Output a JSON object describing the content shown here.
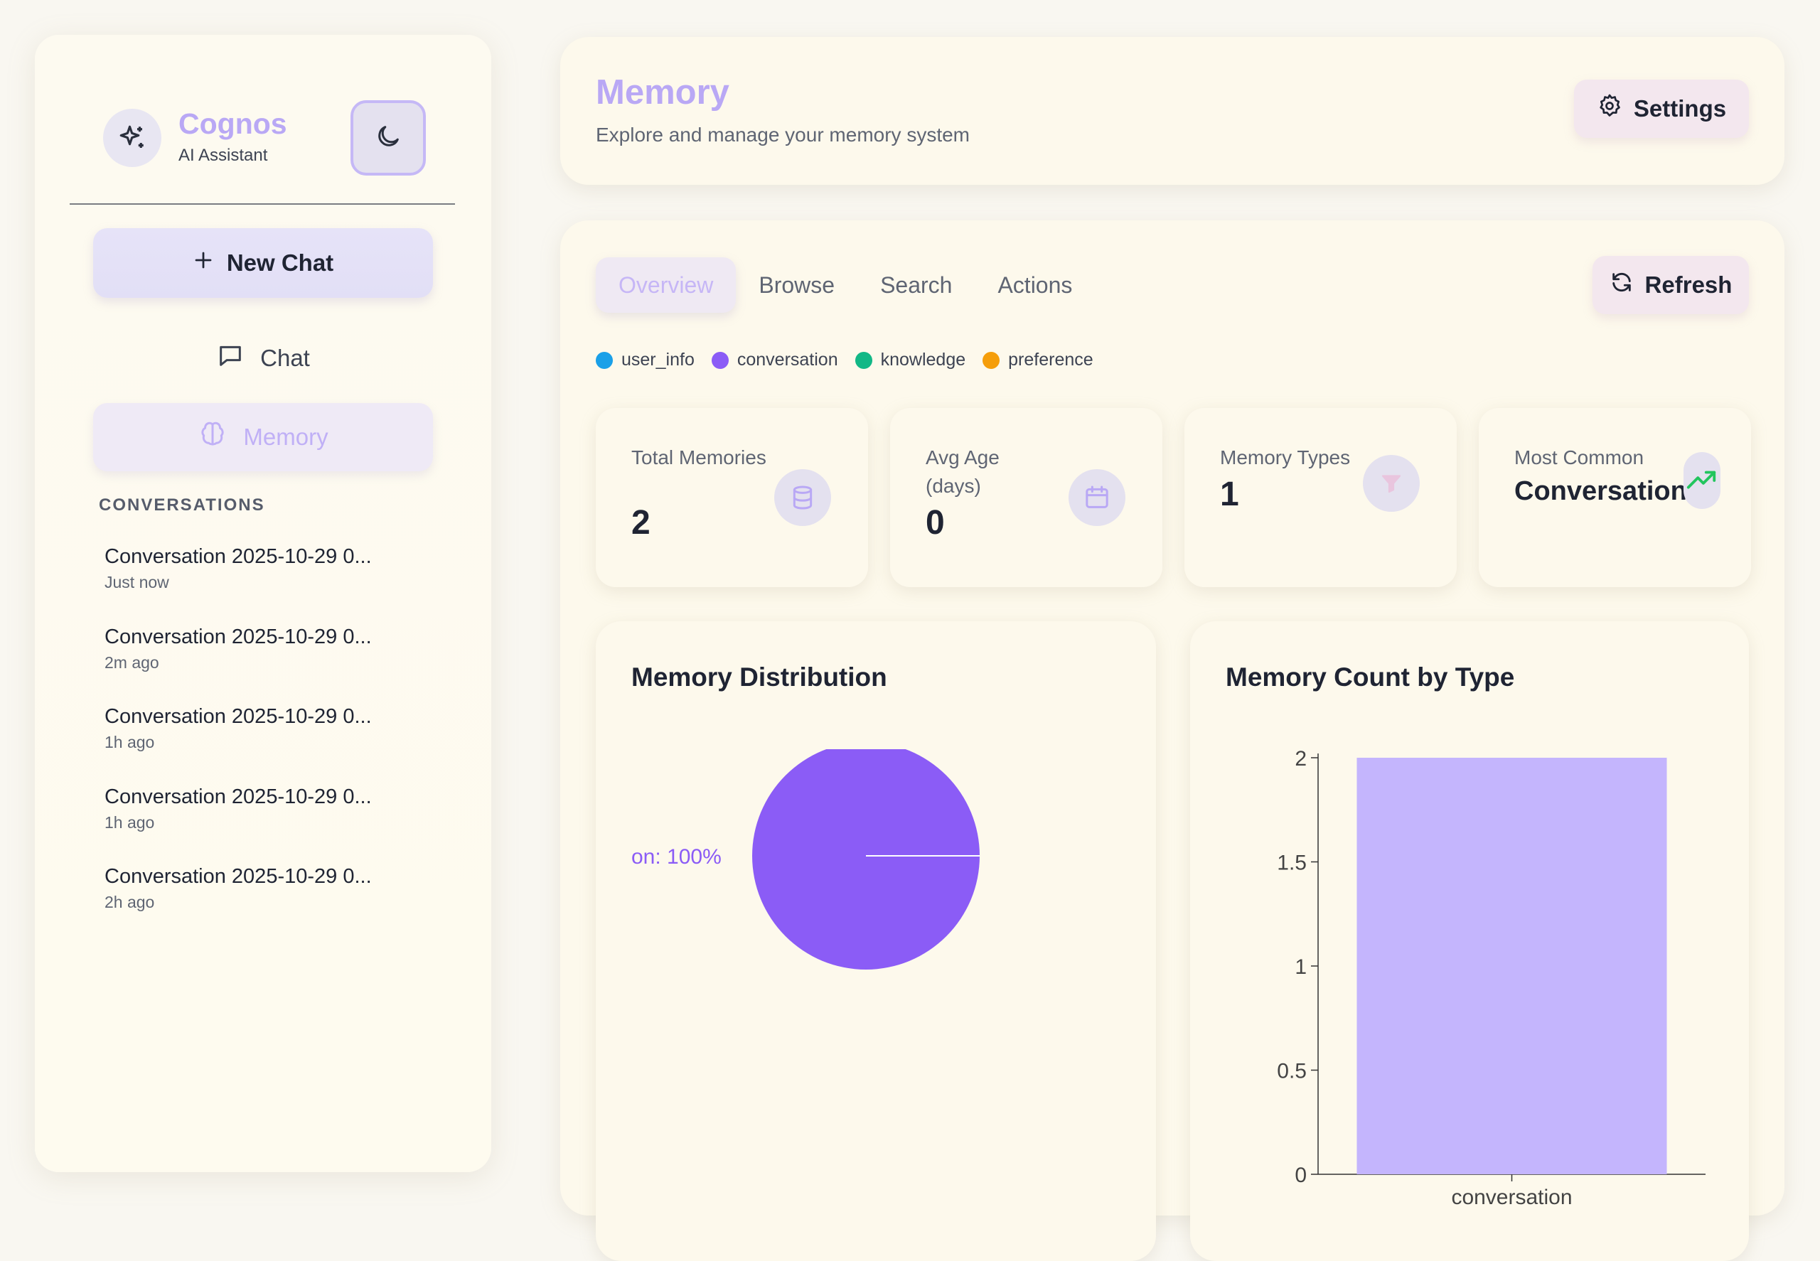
{
  "sidebar": {
    "brand_name": "Cognos",
    "brand_sub": "AI Assistant",
    "new_chat_label": "New Chat",
    "nav_chat_label": "Chat",
    "nav_memory_label": "Memory",
    "conversations_heading": "CONVERSATIONS",
    "conversations": [
      {
        "title": "Conversation 2025-10-29 0...",
        "time": "Just now"
      },
      {
        "title": "Conversation 2025-10-29 0...",
        "time": "2m ago"
      },
      {
        "title": "Conversation 2025-10-29 0...",
        "time": "1h ago"
      },
      {
        "title": "Conversation 2025-10-29 0...",
        "time": "1h ago"
      },
      {
        "title": "Conversation 2025-10-29 0...",
        "time": "2h ago"
      }
    ]
  },
  "header": {
    "title": "Memory",
    "subtitle": "Explore and manage your memory system",
    "settings_label": "Settings"
  },
  "tabs": [
    "Overview",
    "Browse",
    "Search",
    "Actions"
  ],
  "refresh_label": "Refresh",
  "legend": [
    {
      "label": "user_info",
      "color": "#1aa0e8"
    },
    {
      "label": "conversation",
      "color": "#8b5cf6"
    },
    {
      "label": "knowledge",
      "color": "#12b886"
    },
    {
      "label": "preference",
      "color": "#f59e0b"
    }
  ],
  "stats": [
    {
      "label": "Total Memories",
      "value": "2",
      "icon": "database-icon"
    },
    {
      "label": "Avg Age (days)",
      "value": "0",
      "icon": "calendar-icon"
    },
    {
      "label": "Memory Types",
      "value": "1",
      "icon": "filter-icon"
    },
    {
      "label": "Most Common",
      "value": "Conversation",
      "icon": "trending-up-icon"
    }
  ],
  "colors": {
    "accent": "#b9a8f5",
    "pie": "#8b5cf6",
    "bar": "#c4b5fd",
    "trend": "#22c55e"
  },
  "charts": {
    "pie_title": "Memory Distribution",
    "bar_title": "Memory Count by Type"
  },
  "chart_data": [
    {
      "type": "pie",
      "title": "Memory Distribution",
      "slices": [
        {
          "label": "conversation",
          "value": 100
        }
      ],
      "visible_label": "on: 100%"
    },
    {
      "type": "bar",
      "title": "Memory Count by Type",
      "categories": [
        "conversation"
      ],
      "values": [
        2
      ],
      "ylim": [
        0,
        2
      ],
      "yticks": [
        "2",
        "1.5",
        "1",
        "0.5",
        "0"
      ]
    }
  ]
}
